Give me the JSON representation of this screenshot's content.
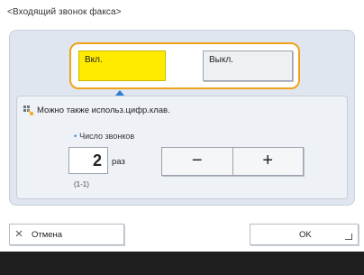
{
  "screen": {
    "title": "<Входящий звонок факса>"
  },
  "toggle": {
    "on_label": "Вкл.",
    "off_label": "Выкл.",
    "selected": "on",
    "accent_color": "#f0a31a",
    "selected_color": "#ffeb00"
  },
  "panel": {
    "hint_icon": "numeric-keypad-icon",
    "hint_text": "Можно также использ.цифр.клав.",
    "field_label": "Число звонков",
    "ring_count": "2",
    "unit": "раз",
    "range": "(1-1)",
    "minus_label": "−",
    "plus_label": "+"
  },
  "footer": {
    "cancel_icon": "close-icon",
    "cancel_label": "Отмена",
    "ok_label": "OK",
    "ok_icon": "enter-corner-icon"
  }
}
